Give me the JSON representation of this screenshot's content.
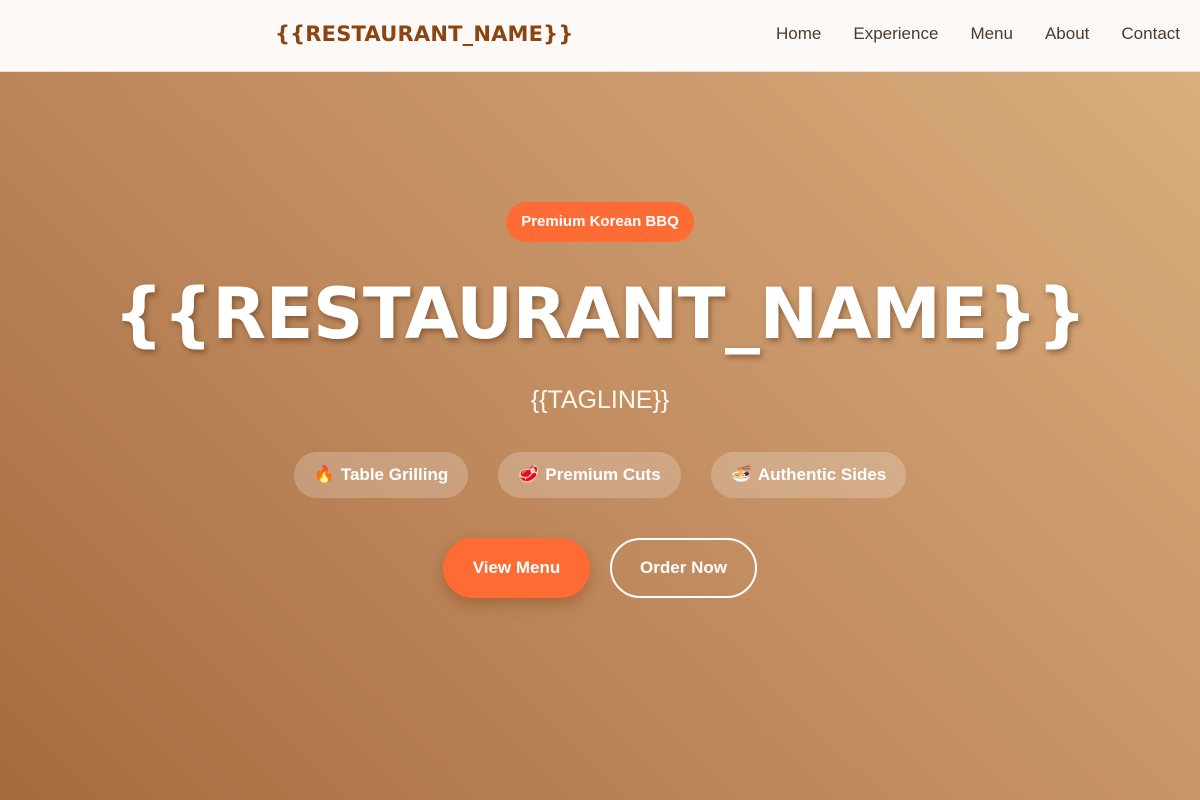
{
  "header": {
    "logo": "{{RESTAURANT_NAME}}",
    "nav": [
      {
        "label": "Home"
      },
      {
        "label": "Experience"
      },
      {
        "label": "Menu"
      },
      {
        "label": "About"
      },
      {
        "label": "Contact"
      }
    ]
  },
  "hero": {
    "badge": "Premium Korean BBQ",
    "title": "{{RESTAURANT_NAME}}",
    "tagline": "{{TAGLINE}}",
    "features": [
      {
        "icon": "🔥",
        "icon_name": "fire-icon",
        "label": "Table Grilling"
      },
      {
        "icon": "🥩",
        "icon_name": "meat-icon",
        "label": "Premium Cuts"
      },
      {
        "icon": "🍜",
        "icon_name": "noodle-bowl-icon",
        "label": "Authentic Sides"
      }
    ],
    "primary_button": "View Menu",
    "secondary_button": "Order Now"
  },
  "colors": {
    "brand": "#8b4513",
    "accent": "#ff6b35",
    "nav_text": "#4b3a2d",
    "header_bg": "#fcf9f6"
  }
}
